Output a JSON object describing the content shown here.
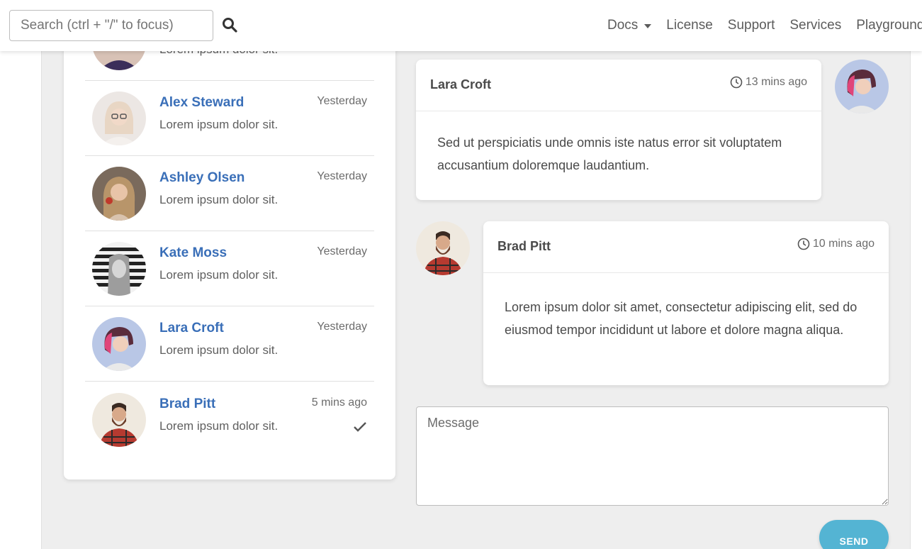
{
  "search": {
    "placeholder": "Search (ctrl + \"/\" to focus)"
  },
  "nav": {
    "docs": "Docs",
    "license": "License",
    "support": "Support",
    "services": "Services",
    "playground": "Playground"
  },
  "contacts": [
    {
      "name": "",
      "message": "Lorem ipsum dolor sit.",
      "time": ""
    },
    {
      "name": "Alex Steward",
      "message": "Lorem ipsum dolor sit.",
      "time": "Yesterday"
    },
    {
      "name": "Ashley Olsen",
      "message": "Lorem ipsum dolor sit.",
      "time": "Yesterday"
    },
    {
      "name": "Kate Moss",
      "message": "Lorem ipsum dolor sit.",
      "time": "Yesterday"
    },
    {
      "name": "Lara Croft",
      "message": "Lorem ipsum dolor sit.",
      "time": "Yesterday"
    },
    {
      "name": "Brad Pitt",
      "message": "Lorem ipsum dolor sit.",
      "time": "5 mins ago"
    }
  ],
  "chat": {
    "messages": [
      {
        "author": "Lara Croft",
        "time": "13 mins ago",
        "text": "Sed ut perspiciatis unde omnis iste natus error sit voluptatem accusantium doloremque laudantium."
      },
      {
        "author": "Brad Pitt",
        "time": "10 mins ago",
        "text": "Lorem ipsum dolor sit amet, consectetur adipiscing elit, sed do eiusmod tempor incididunt ut labore et dolore magna aliqua."
      }
    ],
    "input_placeholder": "Message",
    "send_label": "SEND"
  },
  "colors": {
    "accent": "#3a6fb8",
    "send": "#54b4d3",
    "background": "#eeeeee"
  }
}
